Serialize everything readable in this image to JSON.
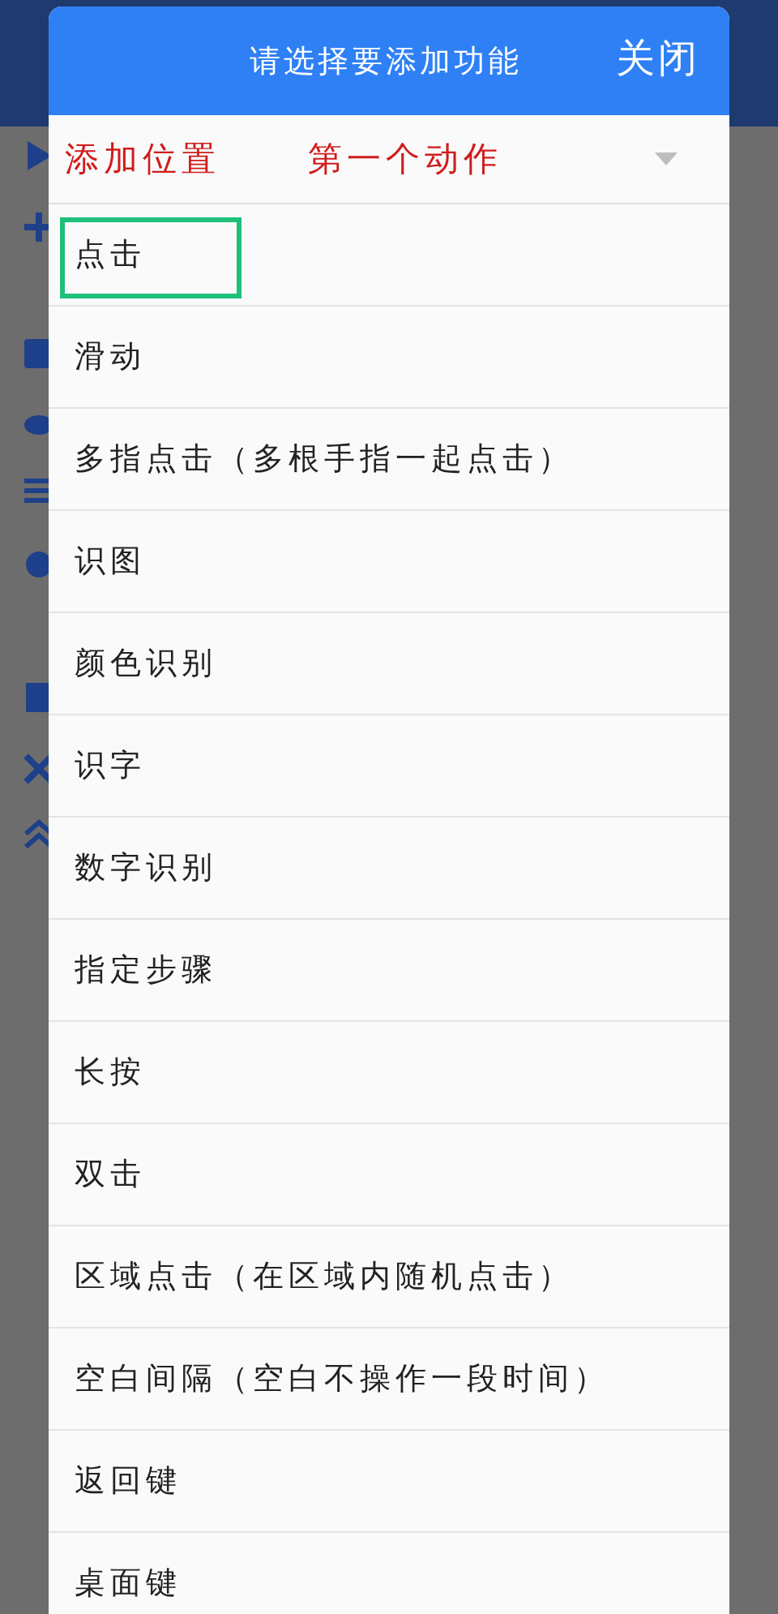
{
  "dialog": {
    "title": "请选择要添加功能",
    "close": "关闭"
  },
  "position": {
    "label": "添加位置",
    "value": "第一个动作"
  },
  "items": [
    {
      "label": "点击",
      "selected": true
    },
    {
      "label": "滑动",
      "selected": false
    },
    {
      "label": "多指点击（多根手指一起点击）",
      "selected": false
    },
    {
      "label": "识图",
      "selected": false
    },
    {
      "label": "颜色识别",
      "selected": false
    },
    {
      "label": "识字",
      "selected": false
    },
    {
      "label": "数字识别",
      "selected": false
    },
    {
      "label": "指定步骤",
      "selected": false
    },
    {
      "label": "长按",
      "selected": false
    },
    {
      "label": "双击",
      "selected": false
    },
    {
      "label": "区域点击（在区域内随机点击）",
      "selected": false
    },
    {
      "label": "空白间隔（空白不操作一段时间）",
      "selected": false
    },
    {
      "label": "返回键",
      "selected": false
    },
    {
      "label": "桌面键",
      "selected": false
    }
  ]
}
